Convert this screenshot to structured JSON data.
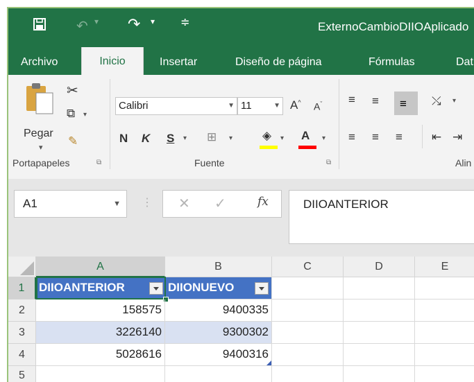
{
  "titlebar": {
    "doc_title": "ExternoCambioDIIOAplicado",
    "save_icon": "save-icon",
    "undo_icon": "undo-icon",
    "redo_icon": "redo-icon",
    "qat_icon": "customize-qat-icon"
  },
  "tabs": [
    "Archivo",
    "Inicio",
    "Insertar",
    "Diseño de página",
    "Fórmulas",
    "Dat"
  ],
  "ribbon": {
    "paste_label": "Pegar",
    "font_name": "Calibri",
    "font_size": "11",
    "bold": "N",
    "italic": "K",
    "underline": "S",
    "group_clipboard": "Portapapeles",
    "group_font": "Fuente",
    "group_alignment": "Alin",
    "highlight_color": "#ffff00",
    "font_color": "#ff0000"
  },
  "formula_bar": {
    "name_box": "A1",
    "fx_label": "fx",
    "formula": "DIIOANTERIOR"
  },
  "grid": {
    "columns": [
      "A",
      "B",
      "C",
      "D",
      "E"
    ],
    "rows": [
      "1",
      "2",
      "3",
      "4",
      "5"
    ],
    "headers": [
      "DIIOANTERIOR",
      "DIIONUEVO"
    ],
    "data": [
      [
        "158575",
        "9400335"
      ],
      [
        "3226140",
        "9300302"
      ],
      [
        "5028616",
        "9400316"
      ]
    ]
  },
  "colors": {
    "accent": "#217346",
    "table_header": "#4472c4",
    "table_band": "#d9e1f2"
  }
}
